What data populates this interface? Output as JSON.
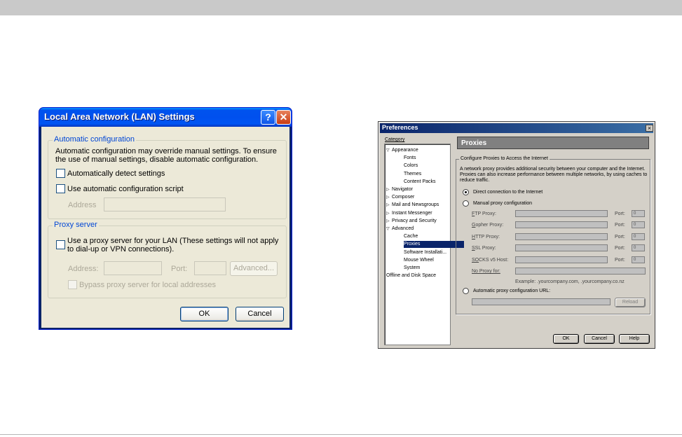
{
  "lan_dialog": {
    "title": "Local Area Network (LAN) Settings",
    "help_glyph": "?",
    "close_glyph": "✕",
    "auto_config": {
      "legend": "Automatic configuration",
      "description": "Automatic configuration may override manual settings.  To ensure the use of manual settings, disable automatic configuration.",
      "detect_label": "Automatically detect settings",
      "detect_checked": false,
      "script_label": "Use automatic configuration script",
      "script_checked": false,
      "address_label": "Address"
    },
    "proxy_server": {
      "legend": "Proxy server",
      "use_proxy_label": "Use a proxy server for your LAN (These settings will not apply to dial-up or VPN connections).",
      "use_proxy_checked": false,
      "address_label": "Address:",
      "port_label": "Port:",
      "advanced_label": "Advanced...",
      "bypass_label": "Bypass proxy server for local addresses"
    },
    "ok_label": "OK",
    "cancel_label": "Cancel"
  },
  "prefs_dialog": {
    "title": "Preferences",
    "close_glyph": "×",
    "category_label": "Category",
    "tree": [
      {
        "label": "Appearance",
        "twisty": "open",
        "level": 0
      },
      {
        "label": "Fonts",
        "level": 1
      },
      {
        "label": "Colors",
        "level": 1
      },
      {
        "label": "Themes",
        "level": 1
      },
      {
        "label": "Content Packs",
        "level": 1
      },
      {
        "label": "Navigator",
        "twisty": "closed",
        "level": 0
      },
      {
        "label": "Composer",
        "twisty": "closed",
        "level": 0
      },
      {
        "label": "Mail and Newsgroups",
        "twisty": "closed",
        "level": 0
      },
      {
        "label": "Instant Messenger",
        "twisty": "closed",
        "level": 0
      },
      {
        "label": "Privacy and Security",
        "twisty": "closed",
        "level": 0
      },
      {
        "label": "Advanced",
        "twisty": "open",
        "level": 0
      },
      {
        "label": "Cache",
        "level": 1
      },
      {
        "label": "Proxies",
        "level": 1,
        "selected": true
      },
      {
        "label": "Software Installati...",
        "level": 1
      },
      {
        "label": "Mouse Wheel",
        "level": 1
      },
      {
        "label": "System",
        "level": 1
      },
      {
        "label": "Offline and Disk Space",
        "level": 0
      }
    ],
    "panel_title": "Proxies",
    "group_legend": "Configure Proxies to Access the Internet",
    "description": "A network proxy provides additional security between your computer and the Internet. Proxies can also increase performance between multiple networks, by using caches to reduce traffic.",
    "radio_direct": "Direct connection to the Internet",
    "radio_manual": "Manual proxy configuration",
    "radio_auto": "Automatic proxy configuration URL:",
    "selected_mode": "direct",
    "proxy_rows": [
      {
        "key": "F",
        "rest": "TP Proxy:",
        "port_label": "Port:",
        "port_value": "0"
      },
      {
        "key": "G",
        "rest": "opher Proxy:",
        "port_label": "Port:",
        "port_value": "0"
      },
      {
        "key": "H",
        "rest": "TTP Proxy:",
        "port_label": "Port:",
        "port_value": "0"
      },
      {
        "key": "S",
        "rest": "SL Proxy:",
        "port_label": "Port:",
        "port_value": "0"
      },
      {
        "key": "SO",
        "rest": "CKS v5 Host:",
        "port_label": "Port:",
        "port_value": "0"
      }
    ],
    "no_proxy_label": "No Proxy for:",
    "example_text": "Example: .yourcompany.com, .yourcompany.co.nz",
    "reload_label": "Reload",
    "ok_label": "OK",
    "cancel_label": "Cancel",
    "help_label": "Help"
  }
}
